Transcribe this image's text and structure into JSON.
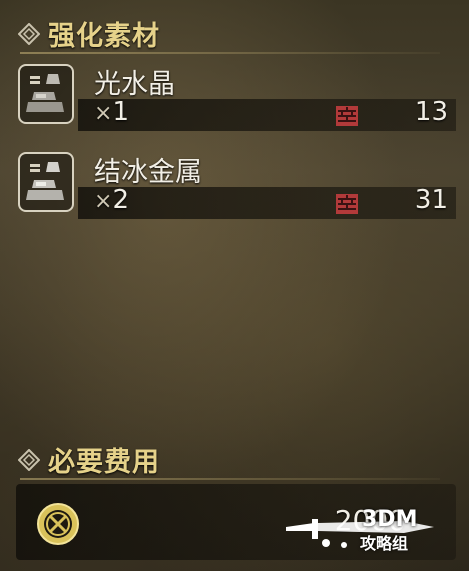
{
  "sections": {
    "materials_title": "强化素材",
    "cost_title": "必要费用"
  },
  "materials": [
    {
      "name": "光水晶",
      "required_mult": "×",
      "required": "1",
      "owned": "13",
      "icon": "ore-icon"
    },
    {
      "name": "结冰金属",
      "required_mult": "×",
      "required": "2",
      "owned": "31",
      "icon": "ore-icon"
    }
  ],
  "cost": {
    "icon": "zenny-coin-icon",
    "value": "2000"
  },
  "watermark": {
    "line1": "3DM",
    "line2": "攻略组"
  },
  "colors": {
    "header_gold": "#e6d28a",
    "box_red": "#b23a3a",
    "text": "#f2efe6"
  }
}
